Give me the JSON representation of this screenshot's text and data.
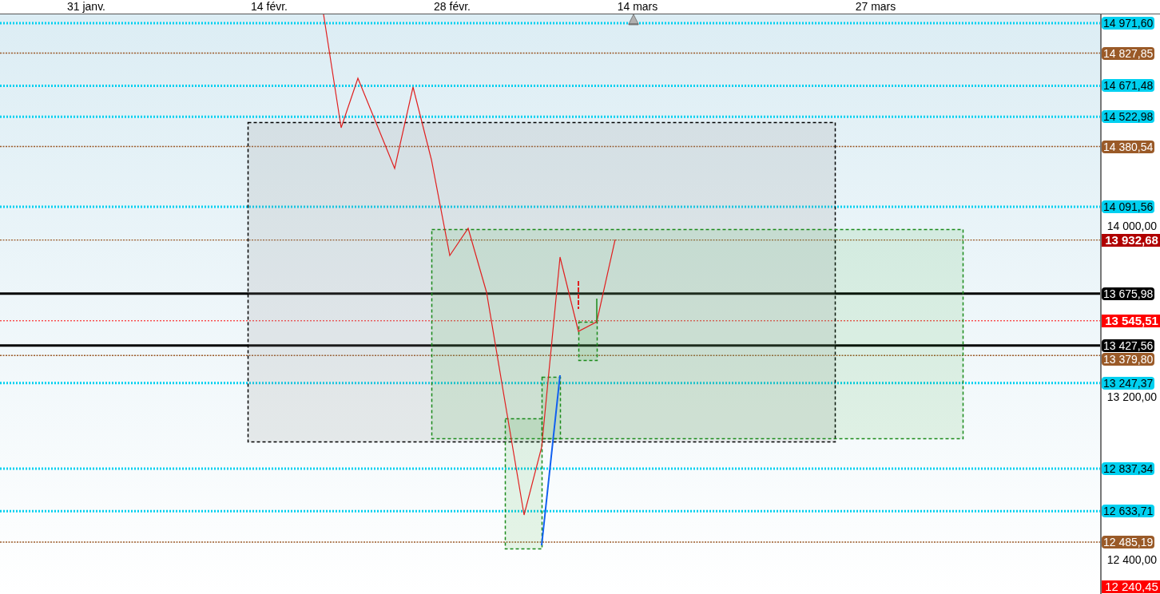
{
  "time_axis": {
    "dates": [
      "31 janv.",
      "14 févr.",
      "28 févr.",
      "14 mars",
      "27 mars"
    ]
  },
  "price_axis": {
    "ticks": [
      "14 000,00",
      "13 200,00",
      "12 400,00"
    ]
  },
  "levels": [
    {
      "price": "14 971,60",
      "kind": "dotted",
      "color": "#00d0f0"
    },
    {
      "price": "14 827,85",
      "kind": "dotted",
      "color": "#9a5a28"
    },
    {
      "price": "14 671,48",
      "kind": "dotted",
      "color": "#00d0f0"
    },
    {
      "price": "14 522,98",
      "kind": "dotted",
      "color": "#00d0f0"
    },
    {
      "price": "14 380,54",
      "kind": "dotted",
      "color": "#9a5a28"
    },
    {
      "price": "14 091,56",
      "kind": "dotted",
      "color": "#00d0f0"
    },
    {
      "price": "13 932,68",
      "kind": "last",
      "color": "#b00000"
    },
    {
      "price": "13 675,98",
      "kind": "solid",
      "color": "#000000"
    },
    {
      "price": "13 545,51",
      "kind": "alert",
      "color": "#ff0000"
    },
    {
      "price": "13 427,56",
      "kind": "solid",
      "color": "#000000"
    },
    {
      "price": "13 379,80",
      "kind": "dotted",
      "color": "#9a5a28"
    },
    {
      "price": "13 247,37",
      "kind": "dotted",
      "color": "#00d0f0"
    },
    {
      "price": "12 837,34",
      "kind": "dotted",
      "color": "#00d0f0"
    },
    {
      "price": "12 633,71",
      "kind": "dotted",
      "color": "#00d0f0"
    },
    {
      "price": "12 485,19",
      "kind": "dotted",
      "color": "#9a5a28"
    },
    {
      "price": "12 240,45",
      "kind": "badge",
      "color": "#ff0000"
    }
  ]
}
